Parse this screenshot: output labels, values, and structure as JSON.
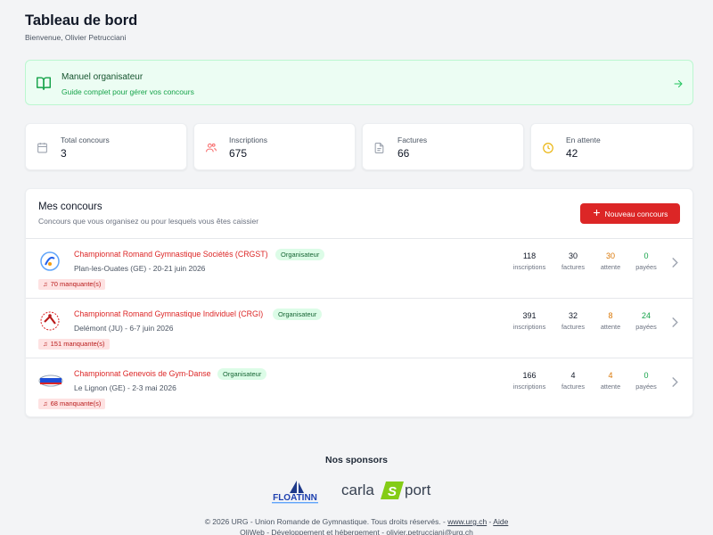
{
  "header": {
    "title": "Tableau de bord",
    "welcome": "Bienvenue, Olivier Petrucciani"
  },
  "manual": {
    "title": "Manuel organisateur",
    "subtitle": "Guide complet pour gérer vos concours",
    "icon": "book-open-icon",
    "arrow_icon": "arrow-right-icon"
  },
  "stats": [
    {
      "label": "Total concours",
      "value": "3",
      "icon": "calendar-icon"
    },
    {
      "label": "Inscriptions",
      "value": "675",
      "icon": "users-icon"
    },
    {
      "label": "Factures",
      "value": "66",
      "icon": "file-text-icon"
    },
    {
      "label": "En attente",
      "value": "42",
      "icon": "clock-icon"
    }
  ],
  "panel": {
    "title": "Mes concours",
    "subtitle": "Concours que vous organisez ou pour lesquels vous êtes caissier",
    "new_button": "Nouveau concours"
  },
  "metric_labels": {
    "inscriptions": "inscriptions",
    "factures": "factures",
    "attente": "attente",
    "payees": "payées"
  },
  "competitions": [
    {
      "name": "Championnat Romand Gymnastique Sociétés (CRGST)",
      "role": "Organisateur",
      "location": "Plan-les-Ouates (GE) - 20-21 juin 2026",
      "missing": "70 manquante(s)",
      "inscriptions": "118",
      "factures": "30",
      "attente": "30",
      "payees": "0"
    },
    {
      "name": "Championnat Romand Gymnastique Individuel (CRGI)",
      "role": "Organisateur",
      "location": "Delémont (JU) - 6-7 juin 2026",
      "missing": "151 manquante(s)",
      "inscriptions": "391",
      "factures": "32",
      "attente": "8",
      "payees": "24"
    },
    {
      "name": "Championnat Genevois de Gym-Danse",
      "role": "Organisateur",
      "location": "Le Lignon (GE) - 2-3 mai 2026",
      "missing": "68 manquante(s)",
      "inscriptions": "166",
      "factures": "4",
      "attente": "4",
      "payees": "0"
    }
  ],
  "sponsors": {
    "title": "Nos sponsors",
    "float_name": "FLOATINN",
    "carla_left": "carla",
    "carla_mark": "S",
    "carla_right": "port"
  },
  "footer": {
    "copyright": "© 2026 URG - Union Romande de Gymnastique. Tous droits réservés. - ",
    "site_link": "www.urg.ch",
    "sep": " - ",
    "help_link": "Aide",
    "credits": "OliWeb - Développement et hébergement - olivier.petrucciani@urg.ch"
  },
  "colors": {
    "accent": "#dc2626",
    "success": "#16a34a",
    "warning": "#d97706"
  }
}
